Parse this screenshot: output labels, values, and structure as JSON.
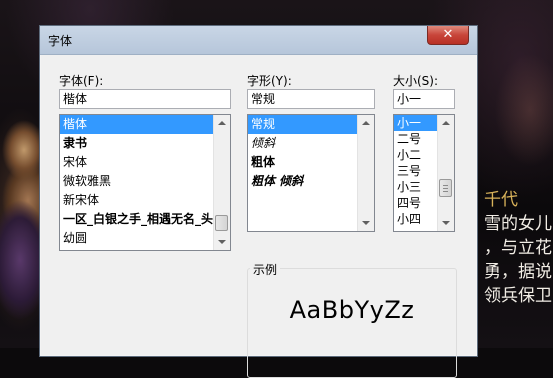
{
  "background": {
    "caption_lines": [
      "千代",
      "雪的女儿",
      "，与立花",
      "勇，据说",
      "领兵保卫"
    ]
  },
  "dialog": {
    "title": "字体",
    "close_glyph": "✕"
  },
  "font": {
    "label": "字体(F):",
    "value": "楷体",
    "items": [
      "楷体",
      "隶书",
      "宋体",
      "微软雅黑",
      "新宋体",
      "一区_白银之手_相遇无名_头",
      "幼圆"
    ],
    "selected_index": 0
  },
  "style": {
    "label": "字形(Y):",
    "value": "常规",
    "items": [
      "常规",
      "倾斜",
      "粗体",
      "粗体 倾斜"
    ],
    "selected_index": 0
  },
  "size": {
    "label": "大小(S):",
    "value": "小一",
    "items": [
      "小一",
      "二号",
      "小二",
      "三号",
      "小三",
      "四号",
      "小四"
    ],
    "selected_index": 0
  },
  "preview": {
    "label": "示例",
    "sample": "AaBbYyZz"
  }
}
